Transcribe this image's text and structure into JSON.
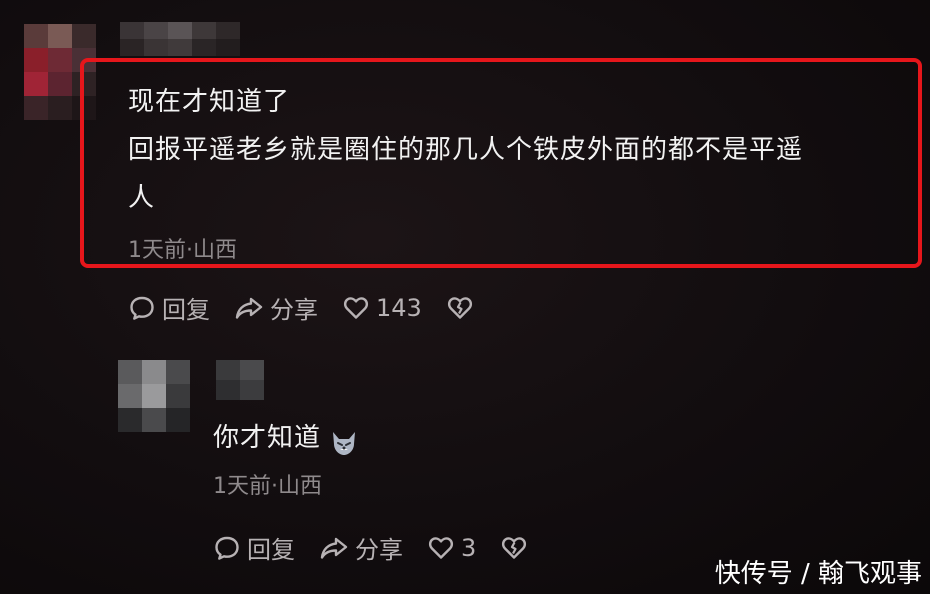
{
  "comment": {
    "line1": "现在才知道了",
    "line2": "回报平遥老乡就是圈住的那几人个铁皮外面的都不是平遥",
    "line3": "人",
    "meta": "1天前·山西",
    "actions": {
      "reply": "回复",
      "share": "分享",
      "likes": "143"
    }
  },
  "reply": {
    "text": "你才知道",
    "emoji_icon": "wolf-emoji-icon",
    "meta": "1天前·山西",
    "actions": {
      "reply": "回复",
      "share": "分享",
      "likes": "3"
    }
  },
  "watermark": "快传号 / 翰飞观事",
  "colors": {
    "highlight": "#e6161b",
    "meta_text": "#8f8a8c",
    "background": "#120d0f"
  }
}
